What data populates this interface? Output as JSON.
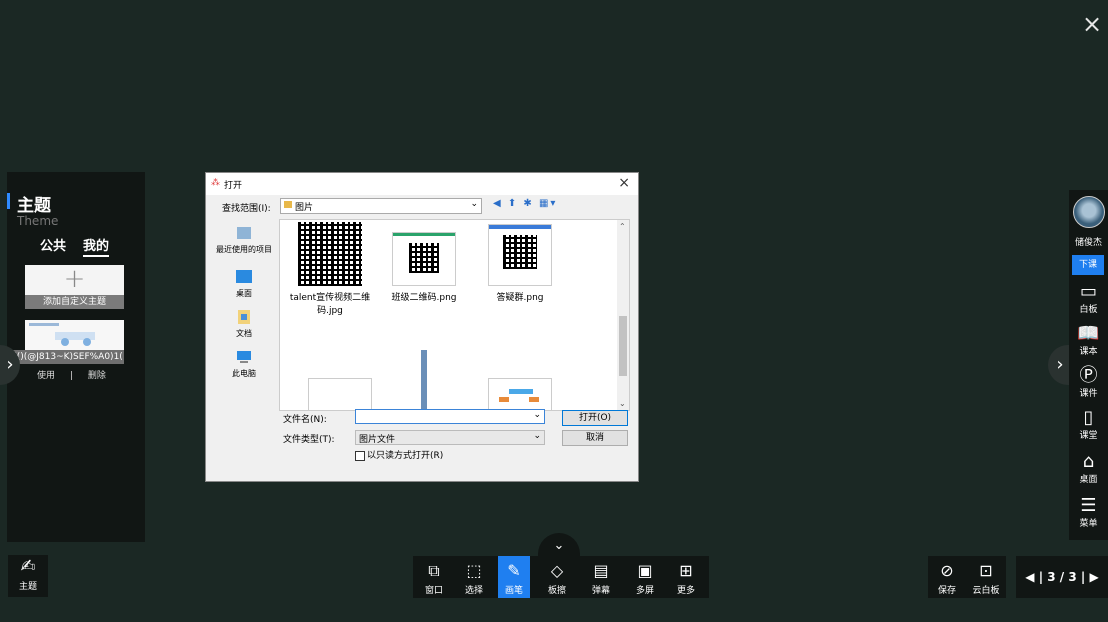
{
  "close_label": "×",
  "theme_panel": {
    "title": "主题",
    "subtitle": "Theme",
    "tabs": [
      "公共",
      "我的"
    ],
    "add_label": "添加自定义主题",
    "add_plus": "+",
    "theme_name": "{()(@J813~K)SEF%A0)1(",
    "use_label": "使用",
    "separator": "|",
    "delete_label": "删除"
  },
  "right_bar": {
    "user_name": "储俊杰",
    "end_class": "下课",
    "items": [
      {
        "icon": "whiteboard-icon",
        "glyph": "▭",
        "label": "白板"
      },
      {
        "icon": "book-icon",
        "glyph": "📖",
        "label": "课本"
      },
      {
        "icon": "courseware-icon",
        "glyph": "Ⓟ",
        "label": "课件"
      },
      {
        "icon": "classroom-icon",
        "glyph": "▯",
        "label": "课堂"
      },
      {
        "icon": "home-icon",
        "glyph": "⌂",
        "label": "桌面"
      },
      {
        "icon": "menu-icon",
        "glyph": "☰",
        "label": "菜单"
      }
    ]
  },
  "dialog": {
    "title": "打开",
    "close": "×",
    "look_in_label": "查找范围(I):",
    "look_in_value": "图片",
    "places": [
      "最近使用的项目",
      "桌面",
      "文档",
      "此电脑"
    ],
    "files": [
      {
        "name": "talent宣传视频二维码.jpg"
      },
      {
        "name": "班级二维码.png"
      },
      {
        "name": "答疑群.png"
      }
    ],
    "file_name_label": "文件名(N):",
    "file_name_value": "",
    "file_type_label": "文件类型(T):",
    "file_type_value": "图片文件",
    "readonly_label": "以只读方式打开(R)",
    "open_button": "打开(O)",
    "cancel_button": "取消"
  },
  "bottom": {
    "theme_label": "主题",
    "collapse": "⌄",
    "toolbar": [
      {
        "icon": "window-icon",
        "glyph": "⧉",
        "label": "窗口"
      },
      {
        "icon": "select-icon",
        "glyph": "⬚",
        "label": "选择"
      },
      {
        "icon": "pen-icon",
        "glyph": "✎",
        "label": "画笔"
      },
      {
        "icon": "eraser-icon",
        "glyph": "◇",
        "label": "板擦"
      },
      {
        "icon": "bullet-comment-icon",
        "glyph": "▤",
        "label": "弹幕"
      },
      {
        "icon": "multi-screen-icon",
        "glyph": "▣",
        "label": "多屏"
      },
      {
        "icon": "more-icon",
        "glyph": "⊞",
        "label": "更多"
      }
    ],
    "save_label": "保存",
    "cloud_board_label": "云白板",
    "page": "3 / 3"
  },
  "colors": {
    "accent": "#1f7ff0",
    "background": "#1b2824",
    "panel": "#111614"
  }
}
